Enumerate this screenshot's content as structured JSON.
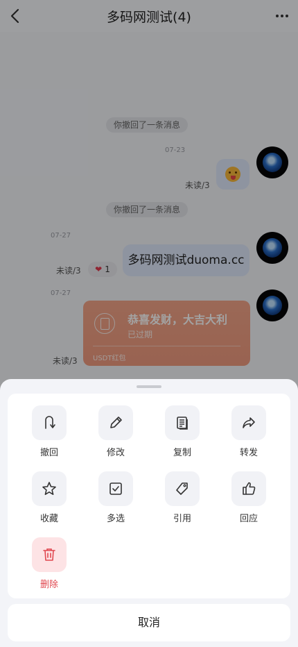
{
  "header": {
    "title": "多码网测试(4)"
  },
  "messages": {
    "system_recall_1": "你撤回了一条消息",
    "time_1": "07-23",
    "unread_1": "未读/3",
    "system_recall_2": "你撤回了一条消息",
    "time_2": "07-27",
    "text_message": "多码网测试duoma.cc",
    "unread_2": "未读/3",
    "reaction_count": "1",
    "time_3": "07-27",
    "redpack": {
      "title": "恭喜发财，大吉大利",
      "status": "已过期",
      "label": "USDT红包"
    },
    "unread_3": "未读/3"
  },
  "action_sheet": {
    "actions": [
      {
        "label": "撤回",
        "icon": "recall-icon"
      },
      {
        "label": "修改",
        "icon": "edit-icon"
      },
      {
        "label": "复制",
        "icon": "copy-icon"
      },
      {
        "label": "转发",
        "icon": "forward-icon"
      },
      {
        "label": "收藏",
        "icon": "star-icon"
      },
      {
        "label": "多选",
        "icon": "checkbox-icon"
      },
      {
        "label": "引用",
        "icon": "quote-icon"
      },
      {
        "label": "回应",
        "icon": "thumbs-up-icon"
      },
      {
        "label": "删除",
        "icon": "trash-icon"
      }
    ],
    "cancel_label": "取消"
  },
  "colors": {
    "danger": "#e0474f",
    "bubble": "#dfe8fb",
    "redpack": "#f09b7f"
  }
}
